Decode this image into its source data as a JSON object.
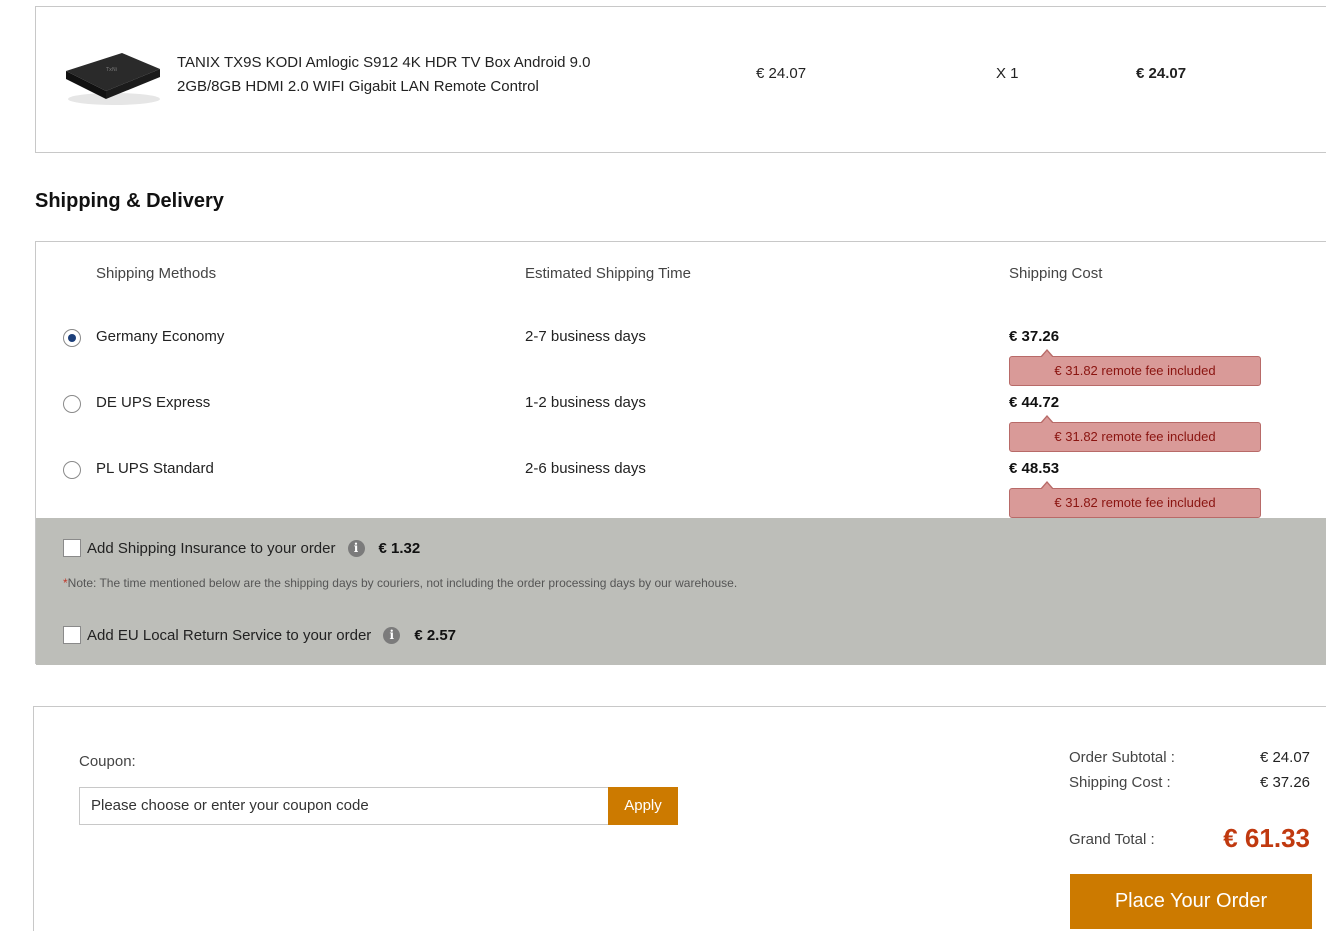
{
  "product": {
    "name": "TANIX TX9S KODI Amlogic S912 4K HDR TV Box Android 9.0 2GB/8GB HDMI 2.0 WIFI Gigabit LAN Remote Control",
    "image_logo_text": "TxNi",
    "price": "€ 24.07",
    "quantity": "X 1",
    "total": "€ 24.07"
  },
  "shipping": {
    "title": "Shipping & Delivery",
    "headers": {
      "method": "Shipping Methods",
      "time": "Estimated Shipping Time",
      "cost": "Shipping Cost"
    },
    "methods": [
      {
        "name": "Germany Economy",
        "time": "2-7 business days",
        "cost": "€ 37.26",
        "fee": "€ 31.82 remote fee included",
        "selected": true
      },
      {
        "name": "DE UPS Express",
        "time": "1-2 business days",
        "cost": "€ 44.72",
        "fee": "€ 31.82 remote fee included",
        "selected": false
      },
      {
        "name": "PL UPS Standard",
        "time": "2-6 business days",
        "cost": "€ 48.53",
        "fee": "€ 31.82 remote fee included",
        "selected": false
      }
    ],
    "insurance": {
      "label": "Add Shipping Insurance to your order",
      "price": "€ 1.32"
    },
    "note_star": "*",
    "note": "Note: The time mentioned below are the shipping days by couriers, not including the order processing days by our warehouse.",
    "return_service": {
      "label": "Add EU Local Return Service to your order",
      "price": "€ 2.57"
    },
    "info_glyph": "i"
  },
  "order": {
    "coupon_label": "Coupon:",
    "coupon_placeholder": "Please choose or enter your coupon code",
    "apply_label": "Apply",
    "subtotal_label": "Order Subtotal :",
    "subtotal_value": "€ 24.07",
    "shipping_label": "Shipping Cost :",
    "shipping_value": "€ 37.26",
    "grand_label": "Grand Total :",
    "grand_value": "€ 61.33",
    "place_order_label": "Place Your Order"
  },
  "colors": {
    "accent": "#cc7a00",
    "grand_total": "#c0390f",
    "fee_tag_bg": "#d99a98",
    "extras_bg": "#bdbeb9"
  }
}
